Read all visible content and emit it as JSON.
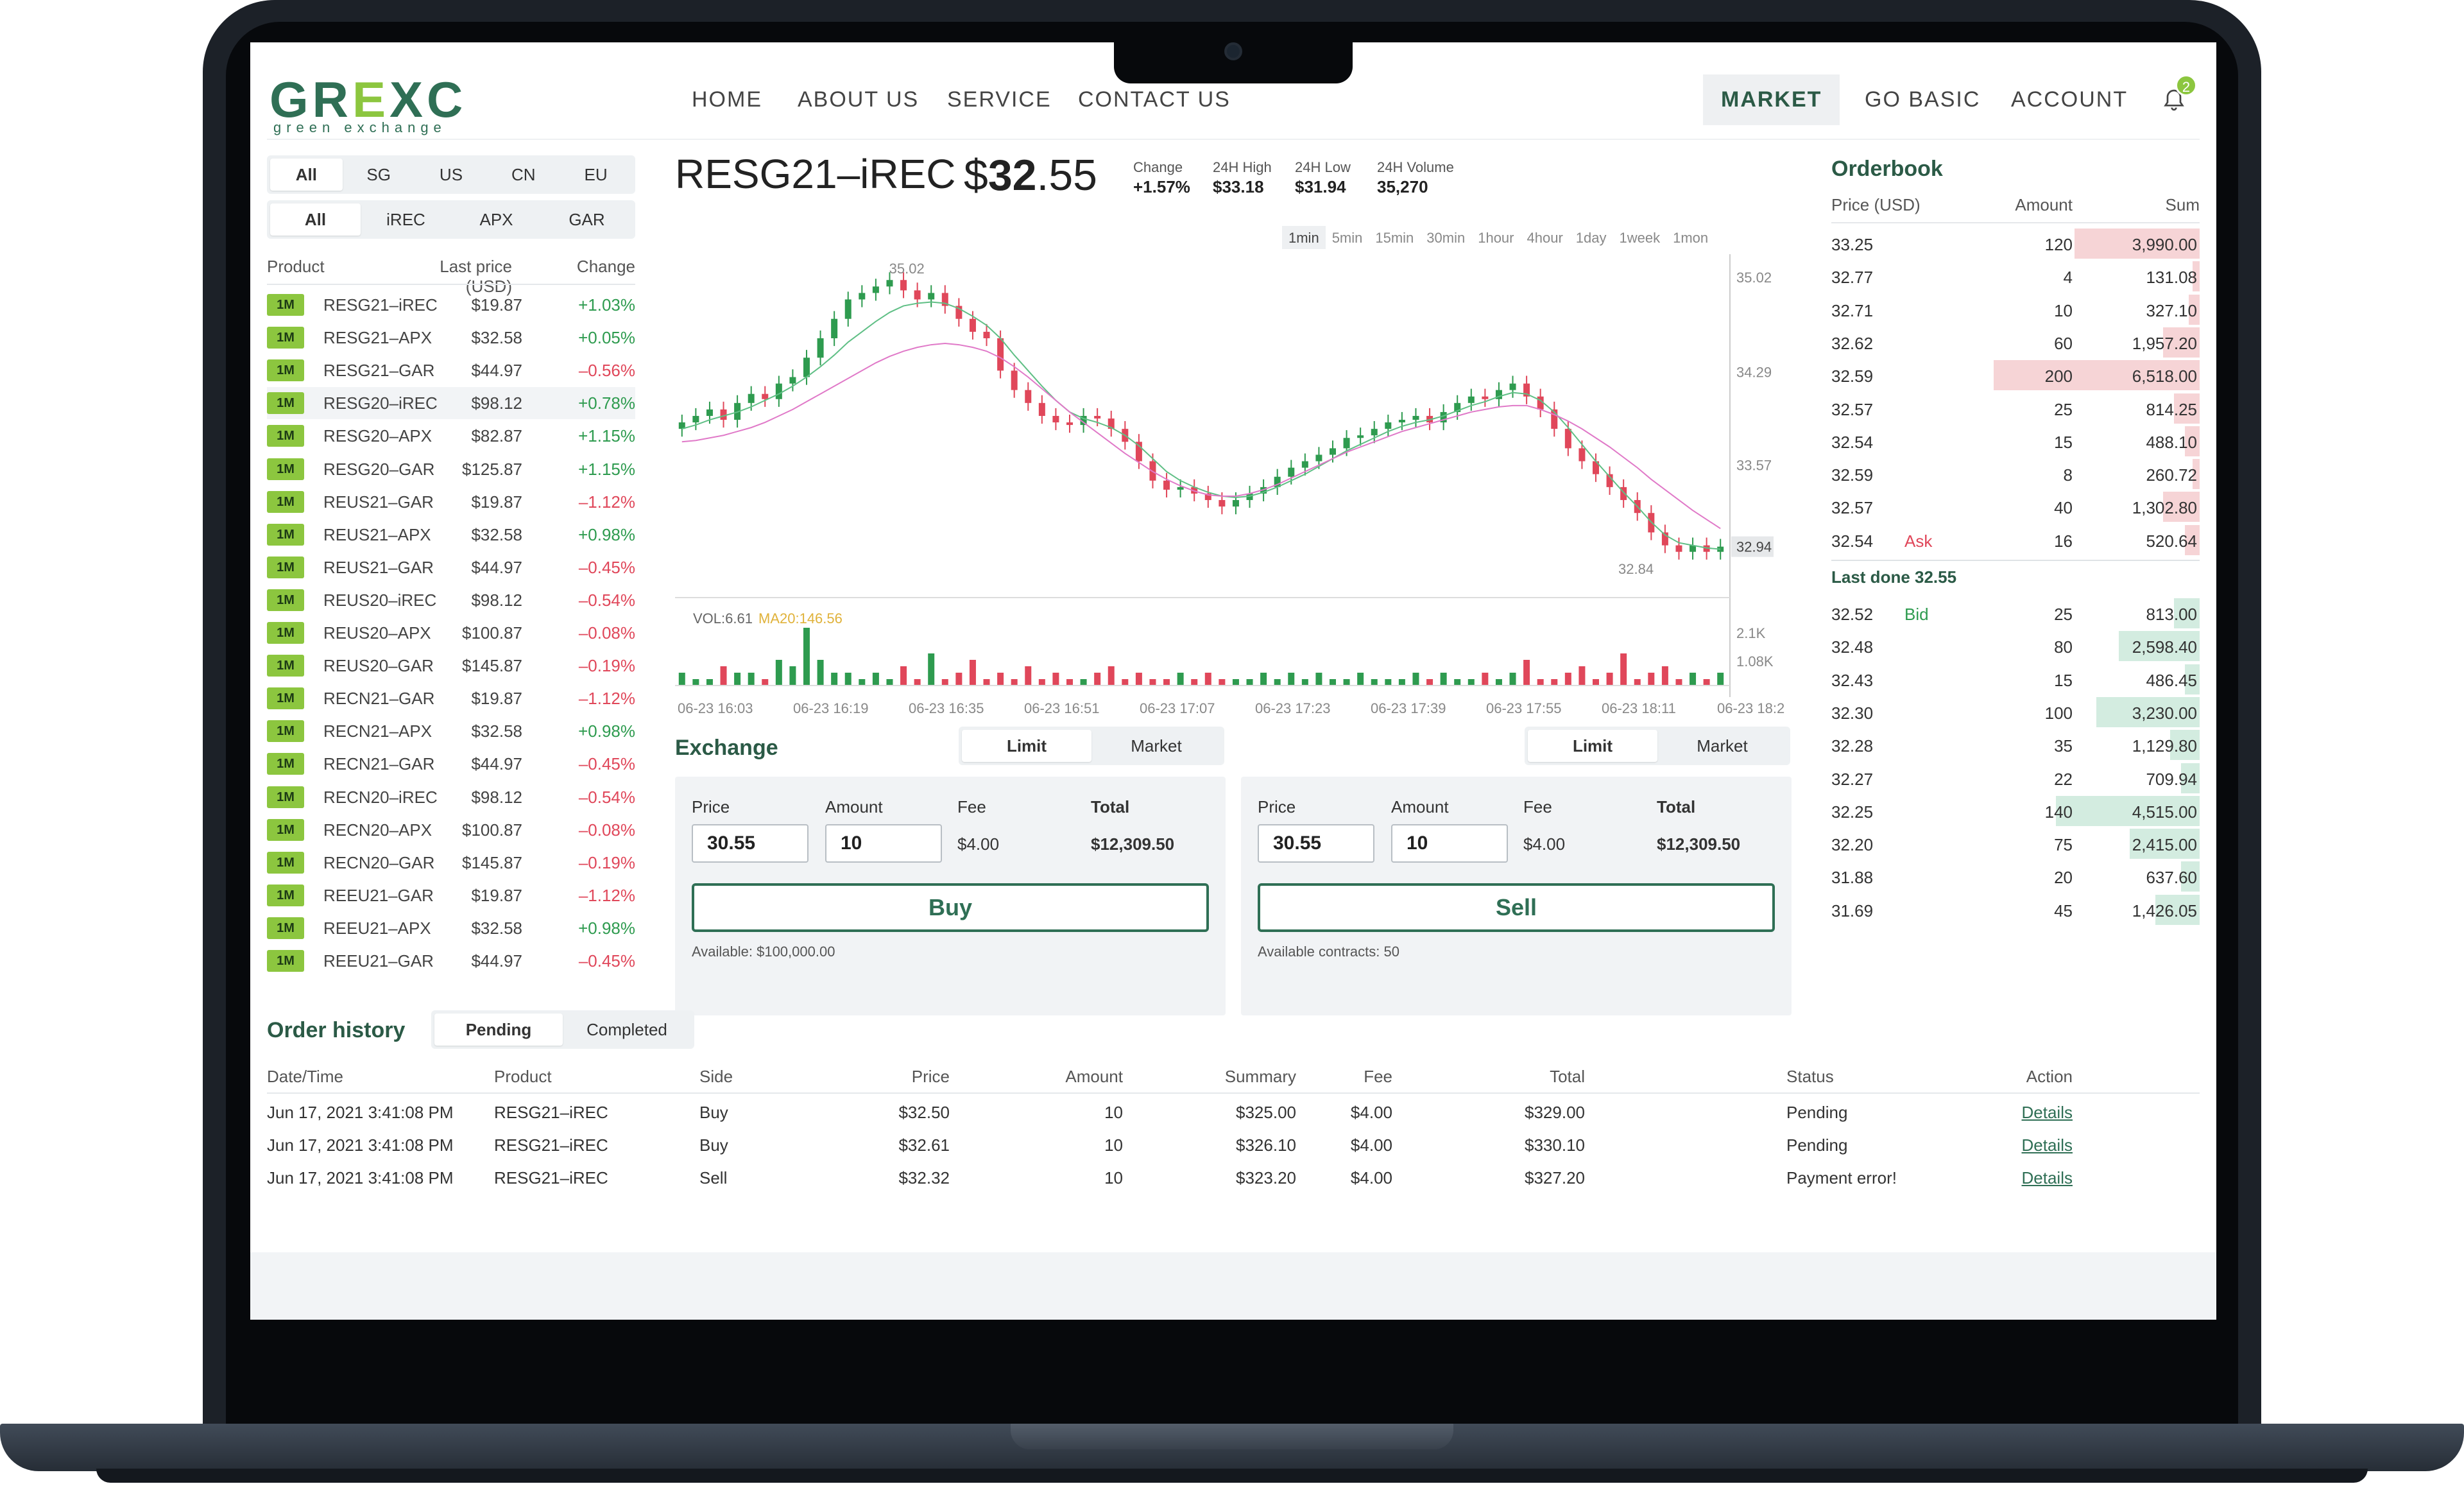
{
  "logo": {
    "mark_pre": "GR",
    "mark_e": "E",
    "mark_post": "XC",
    "sub": "green exchange"
  },
  "nav": {
    "home": "HOME",
    "about": "ABOUT US",
    "service": "SERVICE",
    "contact": "CONTACT US",
    "market": "MARKET",
    "go_basic": "GO BASIC",
    "account": "ACCOUNT",
    "bell_badge": "2"
  },
  "region_tabs": [
    "All",
    "SG",
    "US",
    "CN",
    "EU"
  ],
  "type_tabs": [
    "All",
    "iREC",
    "APX",
    "GAR"
  ],
  "products": {
    "headers": {
      "product": "Product",
      "last": "Last price (USD)",
      "change": "Change"
    },
    "rows": [
      {
        "tag": "1M",
        "name": "RESG21–iREC",
        "price": "$19.87",
        "change": "+1.03%",
        "dir": "up"
      },
      {
        "tag": "1M",
        "name": "RESG21–APX",
        "price": "$32.58",
        "change": "+0.05%",
        "dir": "up"
      },
      {
        "tag": "1M",
        "name": "RESG21–GAR",
        "price": "$44.97",
        "change": "–0.56%",
        "dir": "dn"
      },
      {
        "tag": "1M",
        "name": "RESG20–iREC",
        "price": "$98.12",
        "change": "+0.78%",
        "dir": "up"
      },
      {
        "tag": "1M",
        "name": "RESG20–APX",
        "price": "$82.87",
        "change": "+1.15%",
        "dir": "up"
      },
      {
        "tag": "1M",
        "name": "RESG20–GAR",
        "price": "$125.87",
        "change": "+1.15%",
        "dir": "up"
      },
      {
        "tag": "1M",
        "name": "REUS21–GAR",
        "price": "$19.87",
        "change": "–1.12%",
        "dir": "dn"
      },
      {
        "tag": "1M",
        "name": "REUS21–APX",
        "price": "$32.58",
        "change": "+0.98%",
        "dir": "up"
      },
      {
        "tag": "1M",
        "name": "REUS21–GAR",
        "price": "$44.97",
        "change": "–0.45%",
        "dir": "dn"
      },
      {
        "tag": "1M",
        "name": "REUS20–iREC",
        "price": "$98.12",
        "change": "–0.54%",
        "dir": "dn"
      },
      {
        "tag": "1M",
        "name": "REUS20–APX",
        "price": "$100.87",
        "change": "–0.08%",
        "dir": "dn"
      },
      {
        "tag": "1M",
        "name": "REUS20–GAR",
        "price": "$145.87",
        "change": "–0.19%",
        "dir": "dn"
      },
      {
        "tag": "1M",
        "name": "RECN21–GAR",
        "price": "$19.87",
        "change": "–1.12%",
        "dir": "dn"
      },
      {
        "tag": "1M",
        "name": "RECN21–APX",
        "price": "$32.58",
        "change": "+0.98%",
        "dir": "up"
      },
      {
        "tag": "1M",
        "name": "RECN21–GAR",
        "price": "$44.97",
        "change": "–0.45%",
        "dir": "dn"
      },
      {
        "tag": "1M",
        "name": "RECN20–iREC",
        "price": "$98.12",
        "change": "–0.54%",
        "dir": "dn"
      },
      {
        "tag": "1M",
        "name": "RECN20–APX",
        "price": "$100.87",
        "change": "–0.08%",
        "dir": "dn"
      },
      {
        "tag": "1M",
        "name": "RECN20–GAR",
        "price": "$145.87",
        "change": "–0.19%",
        "dir": "dn"
      },
      {
        "tag": "1M",
        "name": "REEU21–GAR",
        "price": "$19.87",
        "change": "–1.12%",
        "dir": "dn"
      },
      {
        "tag": "1M",
        "name": "REEU21–APX",
        "price": "$32.58",
        "change": "+0.98%",
        "dir": "up"
      },
      {
        "tag": "1M",
        "name": "REEU21–GAR",
        "price": "$44.97",
        "change": "–0.45%",
        "dir": "dn"
      }
    ]
  },
  "ticker": {
    "name": "RESG21–iREC",
    "price_cur": "$",
    "price_int": "32",
    "price_dec": ".55",
    "change_label": "Change",
    "change": "+1.57%",
    "high_label": "24H High",
    "high": "$33.18",
    "low_label": "24H Low",
    "low": "$31.94",
    "vol_label": "24H Volume",
    "vol": "35,270"
  },
  "timeframes": [
    "1min",
    "5min",
    "15min",
    "30min",
    "1hour",
    "4hour",
    "1day",
    "1week",
    "1mon"
  ],
  "chart_data": {
    "type": "candlestick",
    "price_axis": [
      "35.02",
      "34.29",
      "33.57",
      "32.94",
      "32.84"
    ],
    "high_label": "35.02",
    "low_label": "32.84",
    "last_label": "32.94",
    "close": [
      33.9,
      33.95,
      34.0,
      33.92,
      34.05,
      34.12,
      34.08,
      34.2,
      34.25,
      34.4,
      34.55,
      34.7,
      34.85,
      34.9,
      34.95,
      35.0,
      34.92,
      34.85,
      34.9,
      34.8,
      34.7,
      34.6,
      34.55,
      34.3,
      34.15,
      34.05,
      33.95,
      33.9,
      33.88,
      33.95,
      33.93,
      33.85,
      33.75,
      33.6,
      33.45,
      33.38,
      33.4,
      33.35,
      33.3,
      33.25,
      33.3,
      33.35,
      33.4,
      33.48,
      33.55,
      33.6,
      33.65,
      33.7,
      33.78,
      33.8,
      33.85,
      33.9,
      33.92,
      33.95,
      33.9,
      33.98,
      34.05,
      34.1,
      34.08,
      34.15,
      34.2,
      34.1,
      34.0,
      33.85,
      33.7,
      33.6,
      33.5,
      33.4,
      33.3,
      33.2,
      33.05,
      32.95,
      32.9,
      32.95,
      32.9,
      32.94
    ],
    "ma_short": [
      33.85,
      33.88,
      33.92,
      33.95,
      33.98,
      34.02,
      34.07,
      34.12,
      34.18,
      34.25,
      34.33,
      34.42,
      34.52,
      34.6,
      34.68,
      34.75,
      34.8,
      34.82,
      34.83,
      34.82,
      34.78,
      34.72,
      34.65,
      34.55,
      34.42,
      34.3,
      34.18,
      34.07,
      33.98,
      33.93,
      33.9,
      33.86,
      33.8,
      33.72,
      33.62,
      33.52,
      33.45,
      33.4,
      33.36,
      33.33,
      33.32,
      33.33,
      33.36,
      33.4,
      33.45,
      33.5,
      33.56,
      33.62,
      33.68,
      33.73,
      33.78,
      33.83,
      33.87,
      33.9,
      33.92,
      33.95,
      33.99,
      34.03,
      34.06,
      34.1,
      34.13,
      34.12,
      34.07,
      33.98,
      33.86,
      33.73,
      33.6,
      33.48,
      33.36,
      33.25,
      33.13,
      33.03,
      32.97,
      32.95,
      32.93,
      32.92
    ],
    "ma_long": [
      33.75,
      33.76,
      33.78,
      33.8,
      33.83,
      33.86,
      33.9,
      33.95,
      34.0,
      34.06,
      34.12,
      34.18,
      34.24,
      34.3,
      34.36,
      34.41,
      34.45,
      34.48,
      34.5,
      34.51,
      34.5,
      34.48,
      34.45,
      34.4,
      34.33,
      34.25,
      34.16,
      34.07,
      33.98,
      33.9,
      33.82,
      33.74,
      33.66,
      33.59,
      33.52,
      33.46,
      33.41,
      33.37,
      33.34,
      33.33,
      33.33,
      33.35,
      33.38,
      33.42,
      33.47,
      33.52,
      33.57,
      33.62,
      33.67,
      33.71,
      33.75,
      33.79,
      33.83,
      33.86,
      33.89,
      33.92,
      33.95,
      33.98,
      34.0,
      34.02,
      34.03,
      34.03,
      34.0,
      33.96,
      33.91,
      33.85,
      33.78,
      33.71,
      33.63,
      33.55,
      33.46,
      33.38,
      33.3,
      33.22,
      33.15,
      33.08
    ],
    "volume_labels": {
      "vol": "VOL:6.61",
      "ma20": "MA20:146.56",
      "ax1": "2.1K",
      "ax2": "1.08K"
    },
    "volume": [
      2,
      1,
      1,
      3,
      2,
      2,
      1,
      4,
      3,
      9,
      4,
      2,
      2,
      1,
      2,
      1,
      3,
      1,
      5,
      1,
      2,
      4,
      1,
      2,
      1,
      3,
      1,
      2,
      1,
      1,
      2,
      3,
      1,
      2,
      1,
      1,
      2,
      1,
      2,
      1,
      1,
      1,
      2,
      1,
      2,
      1,
      2,
      1,
      1,
      2,
      1,
      1,
      1,
      2,
      1,
      2,
      1,
      1,
      2,
      1,
      2,
      4,
      1,
      1,
      2,
      3,
      1,
      2,
      5,
      1,
      2,
      3,
      1,
      2,
      1,
      2
    ],
    "time_labels": [
      "06-23 16:03",
      "06-23 16:19",
      "06-23 16:35",
      "06-23 16:51",
      "06-23 17:07",
      "06-23 17:23",
      "06-23 17:39",
      "06-23 17:55",
      "06-23 18:11",
      "06-23 18:2"
    ]
  },
  "exchange": {
    "title": "Exchange",
    "buy": {
      "tabs": [
        "Limit",
        "Market"
      ],
      "price_label": "Price",
      "amount_label": "Amount",
      "fee_label": "Fee",
      "total_label": "Total",
      "price": "30.55",
      "amount": "10",
      "fee": "$4.00",
      "total": "$12,309.50",
      "button": "Buy",
      "note": "Available: $100,000.00"
    },
    "sell": {
      "tabs": [
        "Limit",
        "Market"
      ],
      "price_label": "Price",
      "amount_label": "Amount",
      "fee_label": "Fee",
      "total_label": "Total",
      "price": "30.55",
      "amount": "10",
      "fee": "$4.00",
      "total": "$12,309.50",
      "button": "Sell",
      "note": "Available contracts: 50"
    }
  },
  "orderbook": {
    "title": "Orderbook",
    "h_price": "Price (USD)",
    "h_amount": "Amount",
    "h_sum": "Sum",
    "asks": [
      {
        "price": "33.25",
        "amount": "120",
        "sum": "3,990.00",
        "depth": 0.34
      },
      {
        "price": "32.77",
        "amount": "4",
        "sum": "131.08",
        "depth": 0.02
      },
      {
        "price": "32.71",
        "amount": "10",
        "sum": "327.10",
        "depth": 0.03
      },
      {
        "price": "32.62",
        "amount": "60",
        "sum": "1,957.20",
        "depth": 0.1
      },
      {
        "price": "32.59",
        "amount": "200",
        "sum": "6,518.00",
        "depth": 0.56
      },
      {
        "price": "32.57",
        "amount": "25",
        "sum": "814.25",
        "depth": 0.07
      },
      {
        "price": "32.54",
        "amount": "15",
        "sum": "488.10",
        "depth": 0.04
      },
      {
        "price": "32.59",
        "amount": "8",
        "sum": "260.72",
        "depth": 0.02
      },
      {
        "price": "32.57",
        "amount": "40",
        "sum": "1,302.80",
        "depth": 0.1
      },
      {
        "price": "32.54",
        "amount": "16",
        "sum": "520.64",
        "depth": 0.04,
        "tag": "Ask"
      }
    ],
    "last_done": "Last done 32.55",
    "bids": [
      {
        "price": "32.52",
        "amount": "25",
        "sum": "813.00",
        "depth": 0.07,
        "tag": "Bid"
      },
      {
        "price": "32.48",
        "amount": "80",
        "sum": "2,598.40",
        "depth": 0.22
      },
      {
        "price": "32.43",
        "amount": "15",
        "sum": "486.45",
        "depth": 0.04
      },
      {
        "price": "32.30",
        "amount": "100",
        "sum": "3,230.00",
        "depth": 0.28
      },
      {
        "price": "32.28",
        "amount": "35",
        "sum": "1,129.80",
        "depth": 0.08
      },
      {
        "price": "32.27",
        "amount": "22",
        "sum": "709.94",
        "depth": 0.05
      },
      {
        "price": "32.25",
        "amount": "140",
        "sum": "4,515.00",
        "depth": 0.39
      },
      {
        "price": "32.20",
        "amount": "75",
        "sum": "2,415.00",
        "depth": 0.19
      },
      {
        "price": "31.88",
        "amount": "20",
        "sum": "637.60",
        "depth": 0.05
      },
      {
        "price": "31.69",
        "amount": "45",
        "sum": "1,426.05",
        "depth": 0.12
      }
    ]
  },
  "history": {
    "title": "Order history",
    "tabs": [
      "Pending",
      "Completed"
    ],
    "headers": [
      "Date/Time",
      "Product",
      "Side",
      "Price",
      "Amount",
      "Summary",
      "Fee",
      "Total",
      "Status",
      "Action"
    ],
    "rows": [
      [
        "Jun 17, 2021 3:41:08 PM",
        "RESG21–iREC",
        "Buy",
        "$32.50",
        "10",
        "$325.00",
        "$4.00",
        "$329.00",
        "Pending",
        "Details"
      ],
      [
        "Jun 17, 2021 3:41:08 PM",
        "RESG21–iREC",
        "Buy",
        "$32.61",
        "10",
        "$326.10",
        "$4.00",
        "$330.10",
        "Pending",
        "Details"
      ],
      [
        "Jun 17, 2021 3:41:08 PM",
        "RESG21–iREC",
        "Sell",
        "$32.32",
        "10",
        "$323.20",
        "$4.00",
        "$327.20",
        "Payment error!",
        "Details"
      ]
    ]
  }
}
